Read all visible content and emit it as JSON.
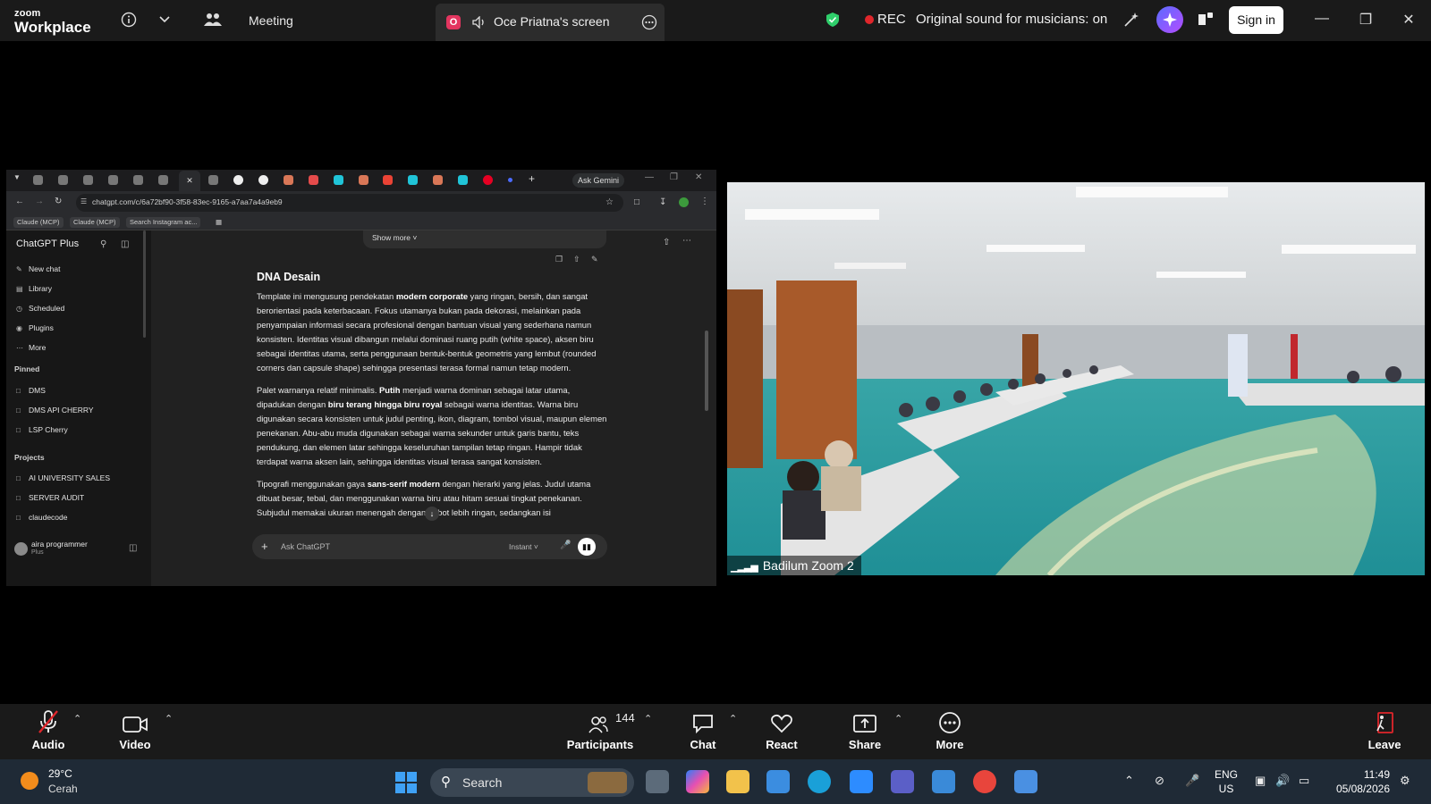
{
  "zoom": {
    "brand_line1": "zoom",
    "brand_line2": "Workplace",
    "meeting_label": "Meeting",
    "screen_badge": "O",
    "screen_title": "Oce Priatna's screen",
    "rec_label": "REC",
    "sound_label": "Original sound for musicians: on",
    "signin_label": "Sign in"
  },
  "browser": {
    "ask_gemini": "Ask Gemini",
    "url": "chatgpt.com/c/6a72bf90-3f58-83ec-9165-a7aa7a4a9eb9",
    "bookmarks": [
      "Claude (MCP)",
      "Claude (MCP)",
      "Search Instagram ac..."
    ]
  },
  "chatgpt": {
    "title": "ChatGPT Plus",
    "nav": [
      "New chat",
      "Library",
      "Scheduled",
      "Plugins",
      "More"
    ],
    "pinned_label": "Pinned",
    "pinned": [
      "DMS",
      "DMS API CHERRY",
      "LSP Cherry"
    ],
    "projects_label": "Projects",
    "projects": [
      "AI UNIVERSITY SALES",
      "SERVER AUDIT",
      "claudecode"
    ],
    "user_name": "aira programmer",
    "user_plan": "Plus",
    "show_more": "Show more",
    "doc_heading": "DNA Desain",
    "p1_a": "Template ini mengusung pendekatan ",
    "p1_b": "modern corporate",
    "p1_c": " yang ringan, bersih, dan sangat berorientasi pada keterbacaan. Fokus utamanya bukan pada dekorasi, melainkan pada penyampaian informasi secara profesional dengan bantuan visual yang sederhana namun konsisten. Identitas visual dibangun melalui dominasi ruang putih (white space), aksen biru sebagai identitas utama, serta penggunaan bentuk-bentuk geometris yang lembut (rounded corners dan capsule shape) sehingga presentasi terasa formal namun tetap modern.",
    "p2_a": "Palet warnanya relatif minimalis. ",
    "p2_b": "Putih",
    "p2_c": " menjadi warna dominan sebagai latar utama, dipadukan dengan ",
    "p2_d": "biru terang hingga biru royal",
    "p2_e": " sebagai warna identitas. Warna biru digunakan secara konsisten untuk judul penting, ikon, diagram, tombol visual, maupun elemen penekanan. Abu-abu muda digunakan sebagai warna sekunder untuk garis bantu, teks pendukung, dan elemen latar sehingga keseluruhan tampilan tetap ringan. Hampir tidak terdapat warna aksen lain, sehingga identitas visual terasa sangat konsisten.",
    "p3_a": "Tipografi menggunakan gaya ",
    "p3_b": "sans-serif modern",
    "p3_c": " dengan hierarki yang jelas. Judul utama dibuat besar, tebal, dan menggunakan warna biru atau hitam sesuai tingkat penekanan. Subjudul memakai ukuran menengah dengan bobot lebih ringan, sedangkan isi",
    "composer_placeholder": "Ask ChatGPT",
    "composer_mode": "Instant"
  },
  "video": {
    "participant_name": "Badilum Zoom 2"
  },
  "toolbar": {
    "audio": "Audio",
    "video": "Video",
    "participants": "Participants",
    "participants_count": "144",
    "chat": "Chat",
    "react": "React",
    "share": "Share",
    "more": "More",
    "leave": "Leave"
  },
  "taskbar": {
    "temperature": "29°C",
    "weather": "Cerah",
    "search": "Search",
    "lang_line1": "ENG",
    "lang_line2": "US",
    "time": "11:49",
    "date": "05/08/2026"
  },
  "colors": {
    "zoom_bar": "#1a1a1a",
    "rec": "#e0262b",
    "screen_badge": "#e3355f",
    "taskbar": "#1f2a36",
    "accent_blue": "#3fa1f5"
  }
}
